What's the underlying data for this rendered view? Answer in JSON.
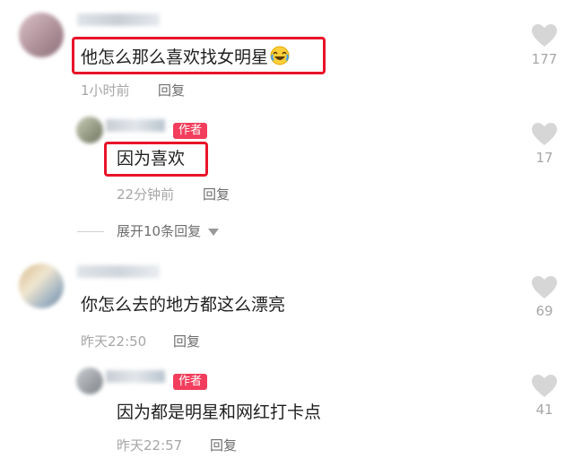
{
  "comments": [
    {
      "text": "他怎么那么喜欢找女明星",
      "time": "1小时前",
      "reply_label": "回复",
      "likes": "177",
      "emoji_icon": "laughing-tears-emoji-icon",
      "reply": {
        "badge": "作者",
        "text": "因为喜欢",
        "time": "22分钟前",
        "reply_label": "回复",
        "likes": "17"
      },
      "expand_label": "展开10条回复"
    },
    {
      "text": "你怎么去的地方都这么漂亮",
      "time": "昨天22:50",
      "reply_label": "回复",
      "likes": "69",
      "reply": {
        "badge": "作者",
        "text": "因为都是明星和网红打卡点",
        "time": "昨天22:57",
        "reply_label": "回复",
        "likes": "41"
      }
    }
  ],
  "colors": {
    "highlight_box": "#e8142a",
    "author_badge": "#f23d5c",
    "like_icon": "#d6d6d6"
  }
}
